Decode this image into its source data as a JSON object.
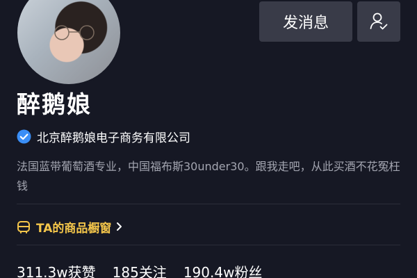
{
  "profile": {
    "name": "醉鹅娘",
    "verification": "北京醉鹅娘电子商务有限公司",
    "bio": "法国蓝带葡萄酒专业，中国福布斯30under30。跟我走吧，从此买酒不花冤枉钱"
  },
  "actions": {
    "message_label": "发消息",
    "follow_icon": "user-check-icon"
  },
  "shop": {
    "label": "TA的商品橱窗",
    "icon": "shop-window-icon",
    "accent_color": "#f3c54a"
  },
  "stats": {
    "likes_value": "311.3w",
    "likes_label": "获赞",
    "following_value": "185",
    "following_label": "关注",
    "followers_value": "190.4w",
    "followers_label": "粉丝"
  },
  "colors": {
    "background": "#161824",
    "button": "#393b48",
    "verified_blue": "#3a8ef6",
    "bio_text": "#a3a5b0"
  }
}
